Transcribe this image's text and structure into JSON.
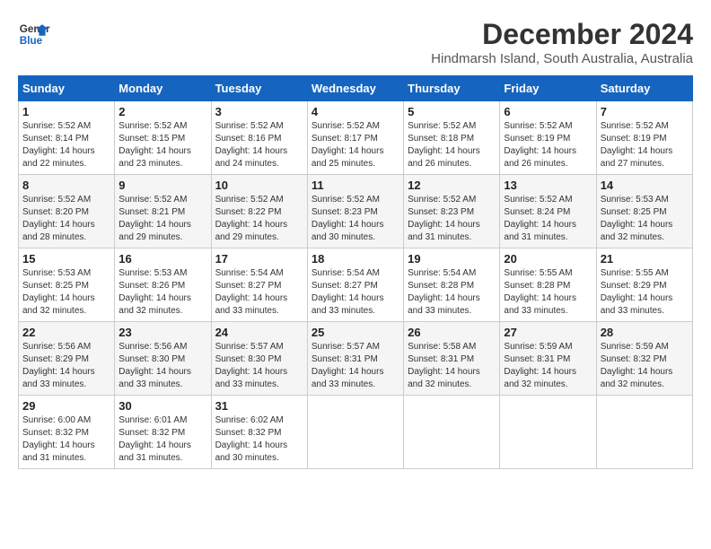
{
  "logo": {
    "line1": "General",
    "line2": "Blue"
  },
  "title": "December 2024",
  "subtitle": "Hindmarsh Island, South Australia, Australia",
  "weekdays": [
    "Sunday",
    "Monday",
    "Tuesday",
    "Wednesday",
    "Thursday",
    "Friday",
    "Saturday"
  ],
  "weeks": [
    [
      {
        "day": "1",
        "sunrise": "5:52 AM",
        "sunset": "8:14 PM",
        "daylight": "14 hours and 22 minutes."
      },
      {
        "day": "2",
        "sunrise": "5:52 AM",
        "sunset": "8:15 PM",
        "daylight": "14 hours and 23 minutes."
      },
      {
        "day": "3",
        "sunrise": "5:52 AM",
        "sunset": "8:16 PM",
        "daylight": "14 hours and 24 minutes."
      },
      {
        "day": "4",
        "sunrise": "5:52 AM",
        "sunset": "8:17 PM",
        "daylight": "14 hours and 25 minutes."
      },
      {
        "day": "5",
        "sunrise": "5:52 AM",
        "sunset": "8:18 PM",
        "daylight": "14 hours and 26 minutes."
      },
      {
        "day": "6",
        "sunrise": "5:52 AM",
        "sunset": "8:19 PM",
        "daylight": "14 hours and 26 minutes."
      },
      {
        "day": "7",
        "sunrise": "5:52 AM",
        "sunset": "8:19 PM",
        "daylight": "14 hours and 27 minutes."
      }
    ],
    [
      {
        "day": "8",
        "sunrise": "5:52 AM",
        "sunset": "8:20 PM",
        "daylight": "14 hours and 28 minutes."
      },
      {
        "day": "9",
        "sunrise": "5:52 AM",
        "sunset": "8:21 PM",
        "daylight": "14 hours and 29 minutes."
      },
      {
        "day": "10",
        "sunrise": "5:52 AM",
        "sunset": "8:22 PM",
        "daylight": "14 hours and 29 minutes."
      },
      {
        "day": "11",
        "sunrise": "5:52 AM",
        "sunset": "8:23 PM",
        "daylight": "14 hours and 30 minutes."
      },
      {
        "day": "12",
        "sunrise": "5:52 AM",
        "sunset": "8:23 PM",
        "daylight": "14 hours and 31 minutes."
      },
      {
        "day": "13",
        "sunrise": "5:52 AM",
        "sunset": "8:24 PM",
        "daylight": "14 hours and 31 minutes."
      },
      {
        "day": "14",
        "sunrise": "5:53 AM",
        "sunset": "8:25 PM",
        "daylight": "14 hours and 32 minutes."
      }
    ],
    [
      {
        "day": "15",
        "sunrise": "5:53 AM",
        "sunset": "8:25 PM",
        "daylight": "14 hours and 32 minutes."
      },
      {
        "day": "16",
        "sunrise": "5:53 AM",
        "sunset": "8:26 PM",
        "daylight": "14 hours and 32 minutes."
      },
      {
        "day": "17",
        "sunrise": "5:54 AM",
        "sunset": "8:27 PM",
        "daylight": "14 hours and 33 minutes."
      },
      {
        "day": "18",
        "sunrise": "5:54 AM",
        "sunset": "8:27 PM",
        "daylight": "14 hours and 33 minutes."
      },
      {
        "day": "19",
        "sunrise": "5:54 AM",
        "sunset": "8:28 PM",
        "daylight": "14 hours and 33 minutes."
      },
      {
        "day": "20",
        "sunrise": "5:55 AM",
        "sunset": "8:28 PM",
        "daylight": "14 hours and 33 minutes."
      },
      {
        "day": "21",
        "sunrise": "5:55 AM",
        "sunset": "8:29 PM",
        "daylight": "14 hours and 33 minutes."
      }
    ],
    [
      {
        "day": "22",
        "sunrise": "5:56 AM",
        "sunset": "8:29 PM",
        "daylight": "14 hours and 33 minutes."
      },
      {
        "day": "23",
        "sunrise": "5:56 AM",
        "sunset": "8:30 PM",
        "daylight": "14 hours and 33 minutes."
      },
      {
        "day": "24",
        "sunrise": "5:57 AM",
        "sunset": "8:30 PM",
        "daylight": "14 hours and 33 minutes."
      },
      {
        "day": "25",
        "sunrise": "5:57 AM",
        "sunset": "8:31 PM",
        "daylight": "14 hours and 33 minutes."
      },
      {
        "day": "26",
        "sunrise": "5:58 AM",
        "sunset": "8:31 PM",
        "daylight": "14 hours and 32 minutes."
      },
      {
        "day": "27",
        "sunrise": "5:59 AM",
        "sunset": "8:31 PM",
        "daylight": "14 hours and 32 minutes."
      },
      {
        "day": "28",
        "sunrise": "5:59 AM",
        "sunset": "8:32 PM",
        "daylight": "14 hours and 32 minutes."
      }
    ],
    [
      {
        "day": "29",
        "sunrise": "6:00 AM",
        "sunset": "8:32 PM",
        "daylight": "14 hours and 31 minutes."
      },
      {
        "day": "30",
        "sunrise": "6:01 AM",
        "sunset": "8:32 PM",
        "daylight": "14 hours and 31 minutes."
      },
      {
        "day": "31",
        "sunrise": "6:02 AM",
        "sunset": "8:32 PM",
        "daylight": "14 hours and 30 minutes."
      },
      null,
      null,
      null,
      null
    ]
  ]
}
